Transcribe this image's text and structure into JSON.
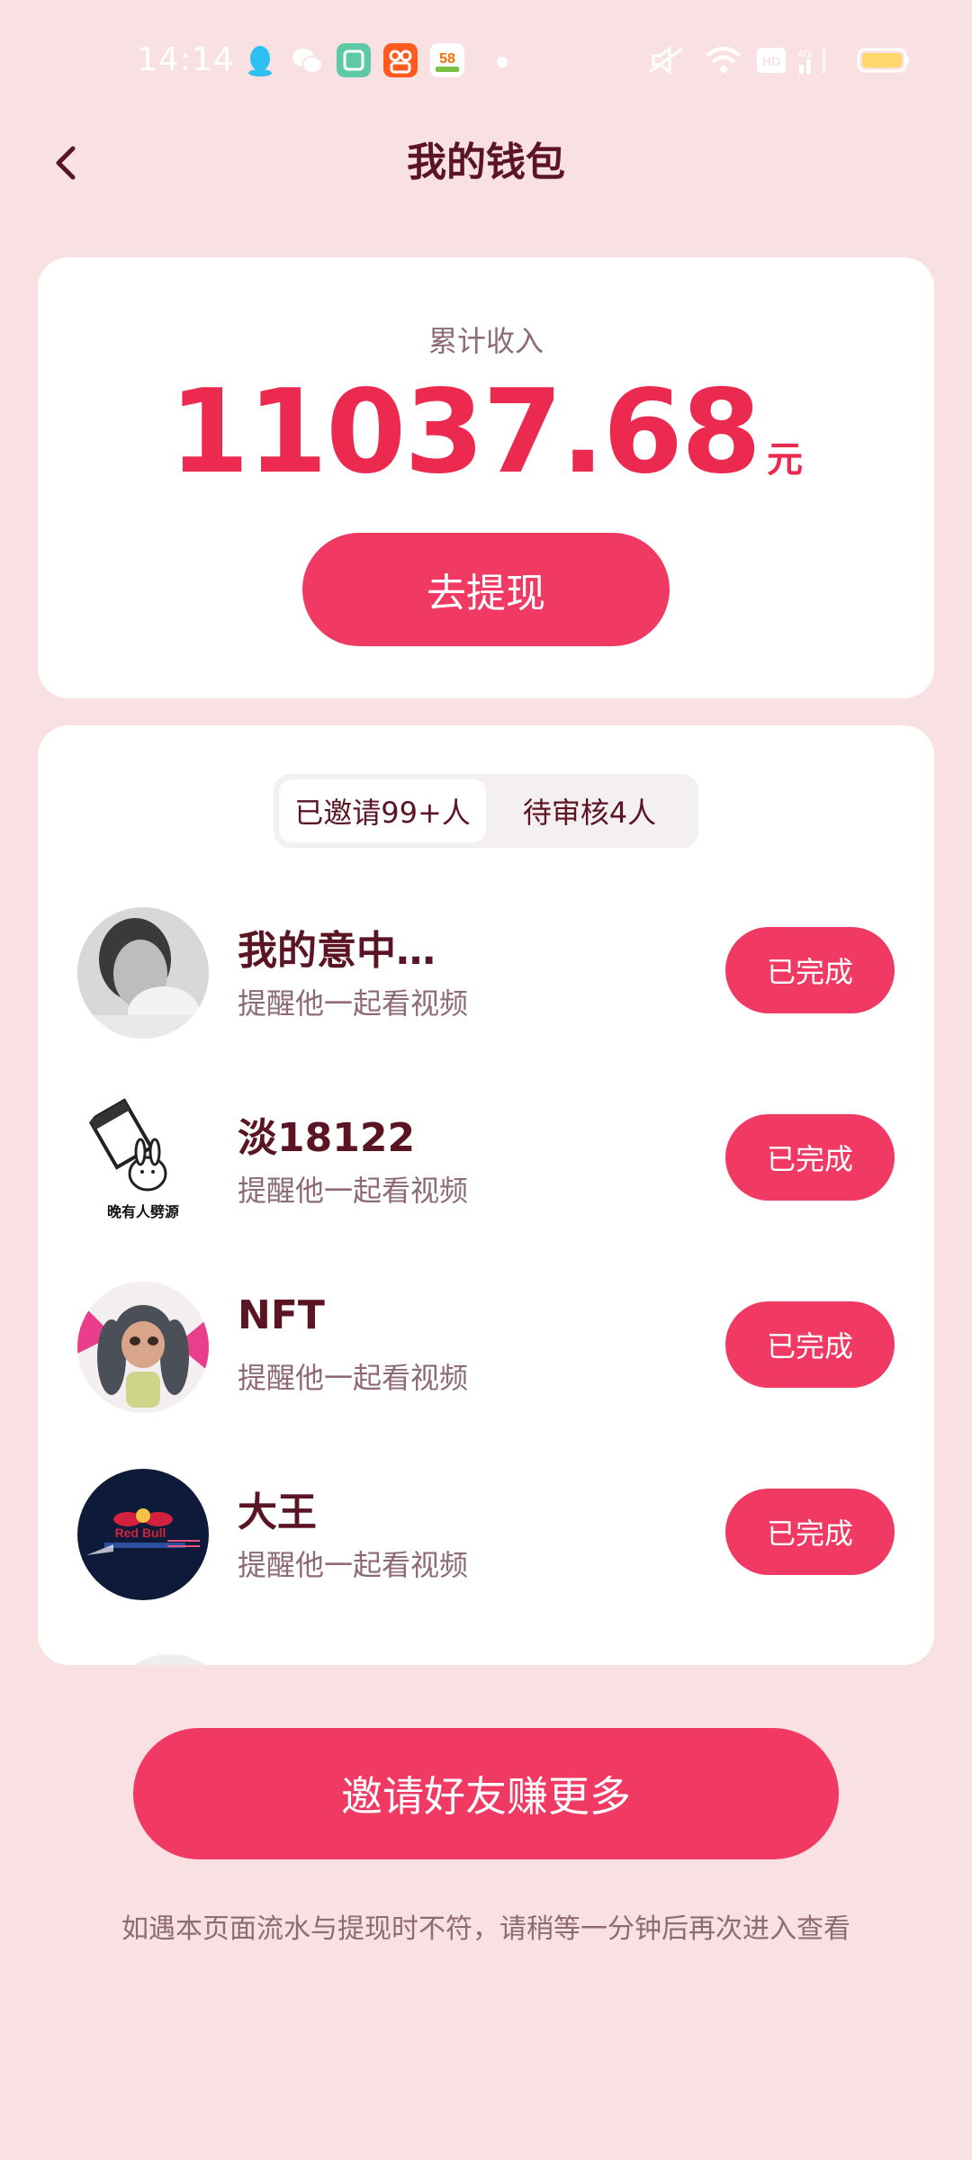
{
  "status_bar": {
    "time": "14:14",
    "network": "4G",
    "hd": "HD",
    "app_badge_58": "58"
  },
  "header": {
    "title": "我的钱包"
  },
  "income": {
    "label": "累计收入",
    "amount": "11037.68",
    "unit": "元",
    "withdraw_label": "去提现"
  },
  "tabs": [
    {
      "label": "已邀请99+人",
      "active": true
    },
    {
      "label": "待审核4人",
      "active": false
    }
  ],
  "invites": [
    {
      "name": "我的意中…",
      "subtitle": "提醒他一起看视频",
      "status": "已完成",
      "avatar": "bw-portrait-avatar"
    },
    {
      "name": "淡18122",
      "subtitle": "提醒他一起看视频",
      "status": "已完成",
      "avatar": "cartoon-rabbit-avatar",
      "avatar_caption": "晚有人劈源"
    },
    {
      "name": "NFT",
      "subtitle": "提醒他一起看视频",
      "status": "已完成",
      "avatar": "3d-girl-avatar"
    },
    {
      "name": "大王",
      "subtitle": "提醒他一起看视频",
      "status": "已完成",
      "avatar": "red-bull-avatar",
      "avatar_caption": "Red Bull"
    }
  ],
  "actions": {
    "invite_more_label": "邀请好友赚更多"
  },
  "note": "如遇本页面流水与提现时不符，请稍等一分钟后再次进入查看",
  "colors": {
    "background": "#f9e0e2",
    "accent": "#f03a63",
    "amount": "#ec2a4f",
    "title_text": "#5a1424",
    "muted_text": "#8e6b73"
  }
}
